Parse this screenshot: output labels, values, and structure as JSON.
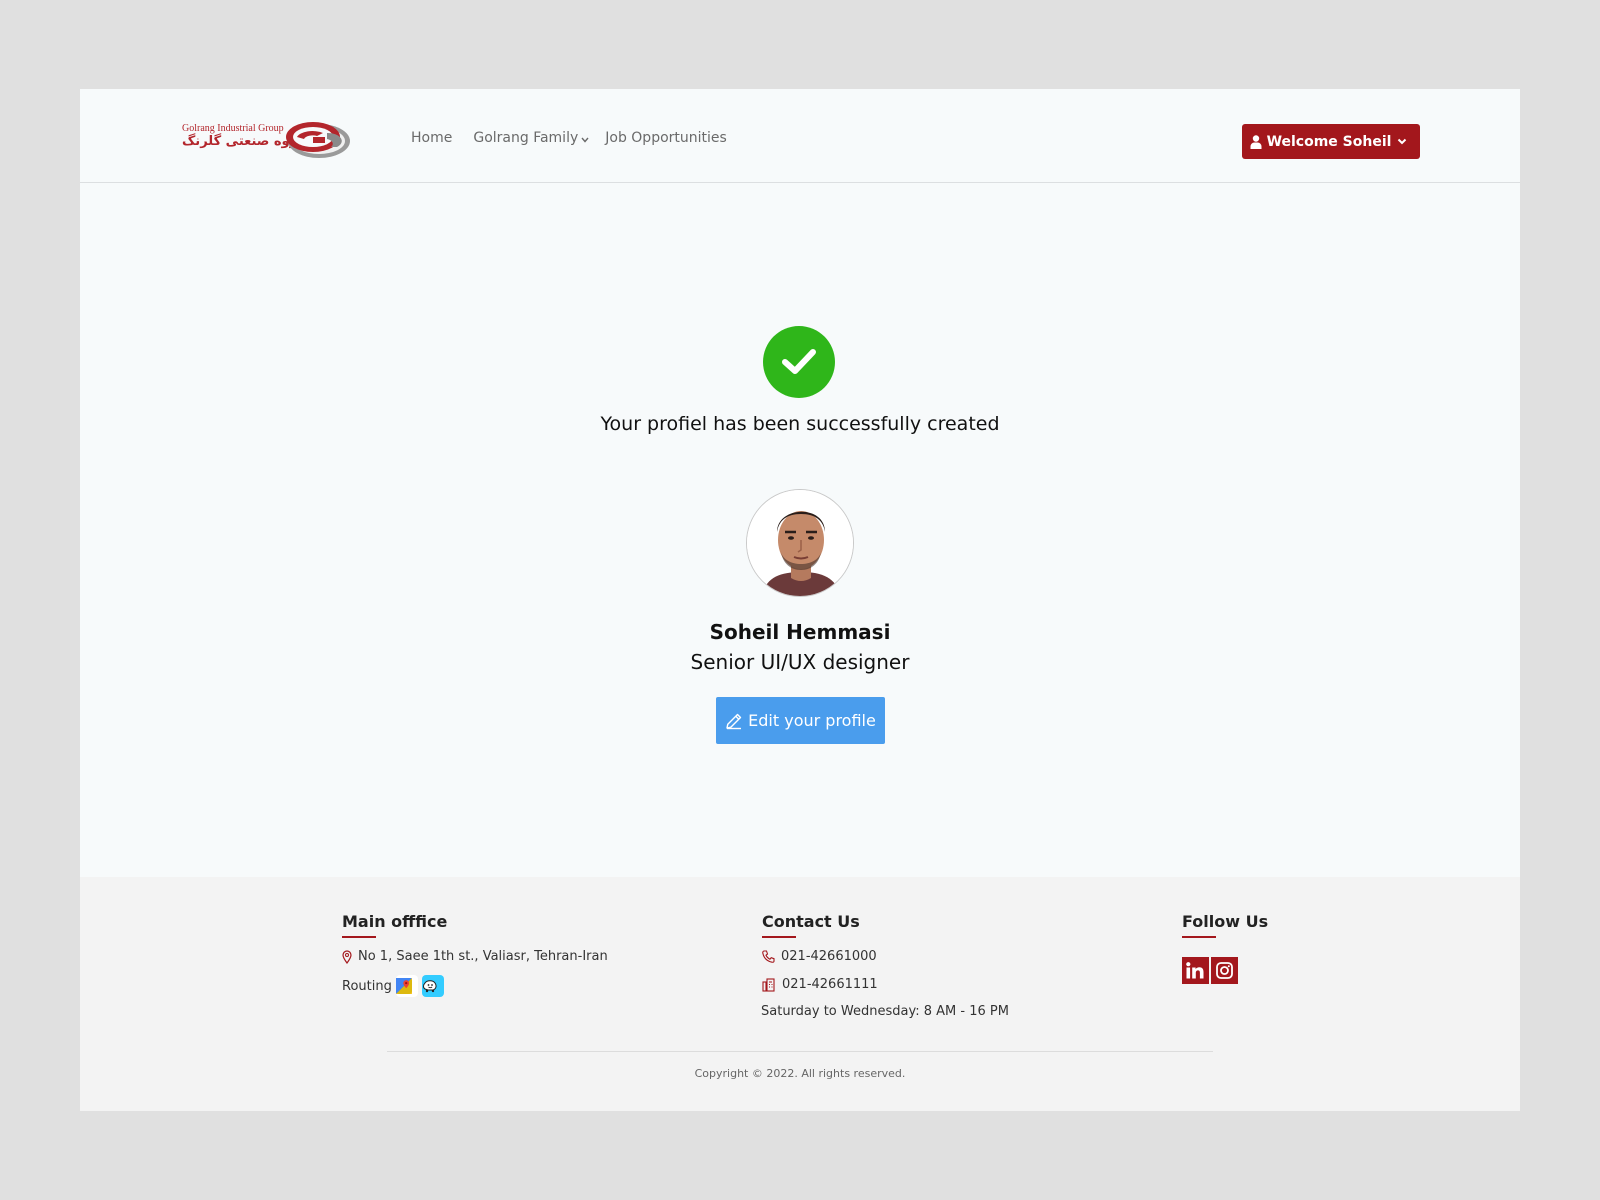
{
  "header": {
    "logo_en": "Golrang Industrial Group",
    "logo_fa": "گروه صنعتی گلرنگ",
    "nav": [
      {
        "label": "Home",
        "dropdown": false
      },
      {
        "label": "Golrang Family",
        "dropdown": true
      },
      {
        "label": "Job Opportunities",
        "dropdown": false
      }
    ],
    "welcome_label": "Welcome Soheil"
  },
  "main": {
    "success_message": "Your profiel has been successfully created",
    "name": "Soheil Hemmasi",
    "role": "Senior UI/UX designer",
    "edit_label": "Edit your profile"
  },
  "footer": {
    "office": {
      "heading": "Main offfice",
      "address": "No 1, Saee 1th st., Valiasr, Tehran-Iran",
      "routing_label": "Routing"
    },
    "contact": {
      "heading": "Contact Us",
      "phone": "021-42661000",
      "fax": "021-42661111",
      "hours": "Saturday to Wednesday: 8 AM - 16 PM"
    },
    "follow": {
      "heading": "Follow Us"
    },
    "copyright": "Copyright © 2022. All rights reserved."
  },
  "colors": {
    "brand_red": "#a3171c",
    "success_green": "#2fb61a",
    "edit_blue": "#4a9ded",
    "page_bg": "#f7fafb",
    "footer_bg": "#f3f3f3"
  },
  "icons": [
    "user-icon",
    "chevron-down-icon",
    "check-icon",
    "pencil-icon",
    "map-pin-icon",
    "phone-icon",
    "fax-icon",
    "google-maps-icon",
    "waze-icon",
    "linkedin-icon",
    "instagram-icon"
  ]
}
